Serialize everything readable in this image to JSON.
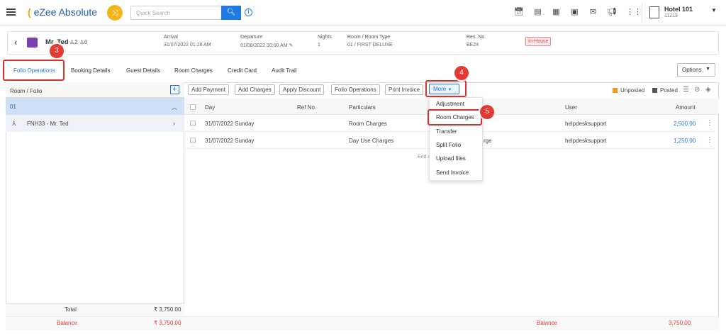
{
  "app": {
    "logo_text": "eZee Absolute",
    "search_placeholder": "Quick Search"
  },
  "hotel": {
    "name": "Hotel 101",
    "code": "11219"
  },
  "guest": {
    "name": "Mr. Ted",
    "adults": "2",
    "children": "0",
    "arrival_label": "Arrival",
    "arrival": "31/07/2022 01:28 AM",
    "departure_label": "Departure",
    "departure": "01/08/2022 10:00 AM",
    "nights_label": "Nights",
    "nights": "1",
    "room_label": "Room / Room Type",
    "room": "01 / FIRST DELUXE",
    "resno_label": "Res. No.",
    "resno": "BE24",
    "status": "In-House"
  },
  "tabs": [
    "Folio Operations",
    "Booking Details",
    "Guest Details",
    "Room Charges",
    "Credit Card",
    "Audit Trail"
  ],
  "options_label": "Options",
  "left": {
    "header": "Room / Folio",
    "room": "01",
    "folio": "FNH33 - Mr. Ted",
    "total_label": "Total",
    "total": "₹ 3,750.00",
    "balance_label": "Balance",
    "balance": "₹ 3,750.00"
  },
  "actions": [
    "Add Payment",
    "Add Charges",
    "Apply Discount",
    "Folio Operations",
    "Print Invoice"
  ],
  "more_label": "More",
  "legend": {
    "unposted": "Unposted",
    "posted": "Posted",
    "unposted_color": "#f39c12",
    "posted_color": "#555555"
  },
  "table": {
    "headers": {
      "day": "Day",
      "ref": "Ref No.",
      "particulars": "Particulars",
      "user": "User",
      "amount": "Amount"
    },
    "rows": [
      {
        "day": "31/07/2022 Sunday",
        "particulars": "Room Charges",
        "user": "helpdesksupport",
        "amount": "2,500.00"
      },
      {
        "day": "31/07/2022 Sunday",
        "particulars": "Day Use Charges",
        "extra": "rge",
        "user": "helpdesksupport",
        "amount": "1,250.00"
      }
    ],
    "end_text": "End o"
  },
  "more_menu": [
    "Adjustment",
    "Room Charges",
    "Transfer",
    "Split Folio",
    "Upload files",
    "Send Invoice"
  ],
  "footer": {
    "balance_label": "Balance",
    "balance": "3,750.00"
  },
  "steps": {
    "s3": "3",
    "s4": "4",
    "s5": "5"
  },
  "colors": {
    "accent": "#1f7ae0",
    "highlight": "#d93030",
    "badge": "#d64545"
  }
}
